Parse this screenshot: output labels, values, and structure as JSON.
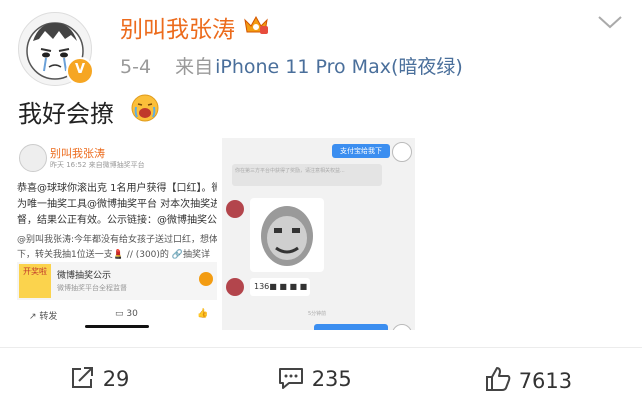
{
  "post": {
    "username": "别叫我张涛",
    "date": "5-4",
    "source_prefix": "来自",
    "source_device": "iPhone 11 Pro Max(暗夜绿)",
    "text": "我好会撩"
  },
  "embedded_left": {
    "username": "别叫我张涛",
    "time": "昨天 16:52 来自微博抽奖平台",
    "line1": "恭喜@球球你滚出克 1名用户获得【口红】。微",
    "line2": "为唯一抽奖工具@微博抽奖平台 对本次抽奖进行",
    "line3": "督，结果公正有效。公示链接：@微博抽奖公示",
    "line4": "@别叫我张涛:今年都没有给女孩子送过口红，想体",
    "line5": "下，转关我抽1位送一支💄 // (300)的 🔗抽奖详",
    "card_icon_text": "开奖啦",
    "card_title": "微博抽奖公示",
    "card_sub": "微博抽奖平台全程监督",
    "repost_label": "转发",
    "comment_count": "30"
  },
  "embedded_right": {
    "bubble_top": "支付宝给我下",
    "notice": "你在第三方平台中获得了奖励，请注意相关权益...",
    "number_msg": "136■ ■ ■ ■",
    "time_label": "5分钟前"
  },
  "actions": {
    "repost": "29",
    "comment": "235",
    "like": "7613"
  },
  "colors": {
    "username": "#ec6b1c",
    "meta": "#9a9a9a",
    "source_link": "#4a6f9b",
    "chat_bubble": "#3b8ef0"
  }
}
